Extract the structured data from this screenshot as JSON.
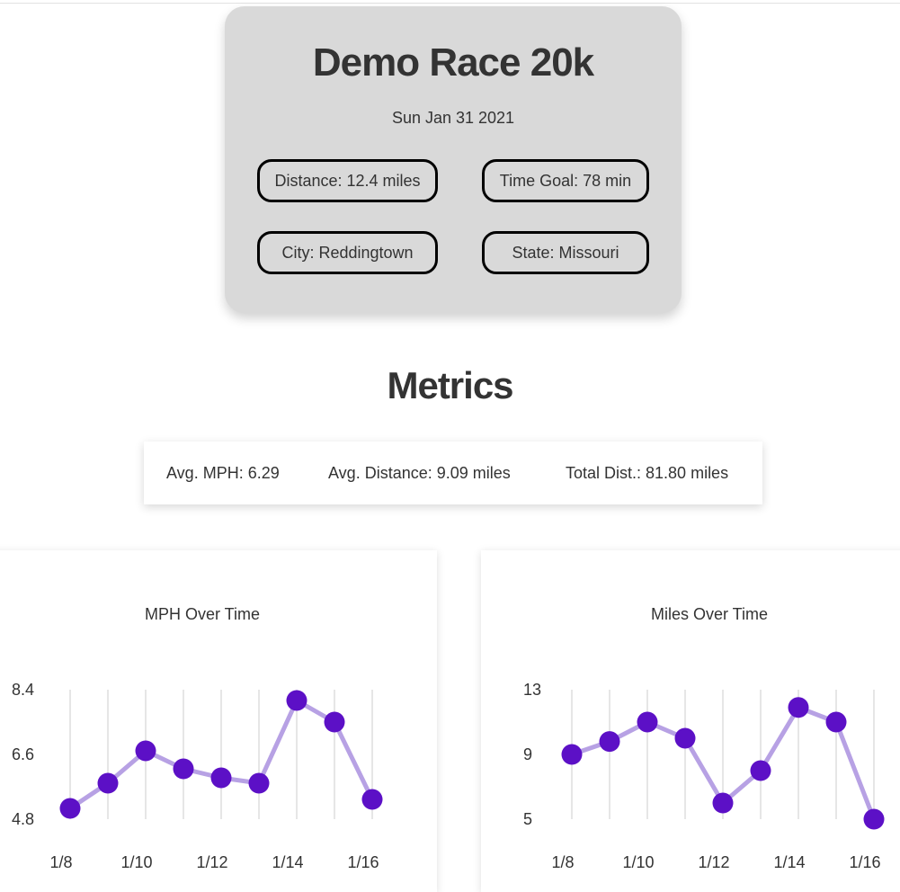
{
  "race": {
    "title": "Demo Race 20k",
    "date": "Sun Jan 31 2021",
    "distance": "Distance: 12.4 miles",
    "time_goal": "Time Goal: 78 min",
    "city": "City: Reddingtown",
    "state": "State: Missouri"
  },
  "metrics": {
    "heading": "Metrics",
    "avg_mph": "Avg. MPH: 6.29",
    "avg_distance": "Avg. Distance: 9.09 miles",
    "total_distance": "Total Dist.: 81.80 miles"
  },
  "colors": {
    "point": "#5c10c6",
    "line": "#b7a1e4",
    "grid": "#cccccc"
  },
  "chart_data": [
    {
      "type": "line",
      "title": "MPH Over Time",
      "x": [
        "1/8",
        "1/9",
        "1/10",
        "1/11",
        "1/12",
        "1/13",
        "1/14",
        "1/15",
        "1/16"
      ],
      "x_tick_labels": [
        "1/8",
        "1/10",
        "1/12",
        "1/14",
        "1/16"
      ],
      "values": [
        5.1,
        5.8,
        6.7,
        6.2,
        5.95,
        5.8,
        8.1,
        7.5,
        5.35
      ],
      "yticks": [
        4.8,
        6.6,
        8.4
      ],
      "ylim": [
        4.8,
        8.4
      ],
      "grid": "vertical"
    },
    {
      "type": "line",
      "title": "Miles Over Time",
      "x": [
        "1/8",
        "1/9",
        "1/10",
        "1/11",
        "1/12",
        "1/13",
        "1/14",
        "1/15",
        "1/16"
      ],
      "x_tick_labels": [
        "1/8",
        "1/10",
        "1/12",
        "1/14",
        "1/16"
      ],
      "values": [
        9,
        9.8,
        11,
        10,
        6,
        8,
        11.9,
        11,
        5
      ],
      "yticks": [
        5,
        9,
        13
      ],
      "ylim": [
        5,
        13
      ],
      "grid": "vertical"
    }
  ]
}
